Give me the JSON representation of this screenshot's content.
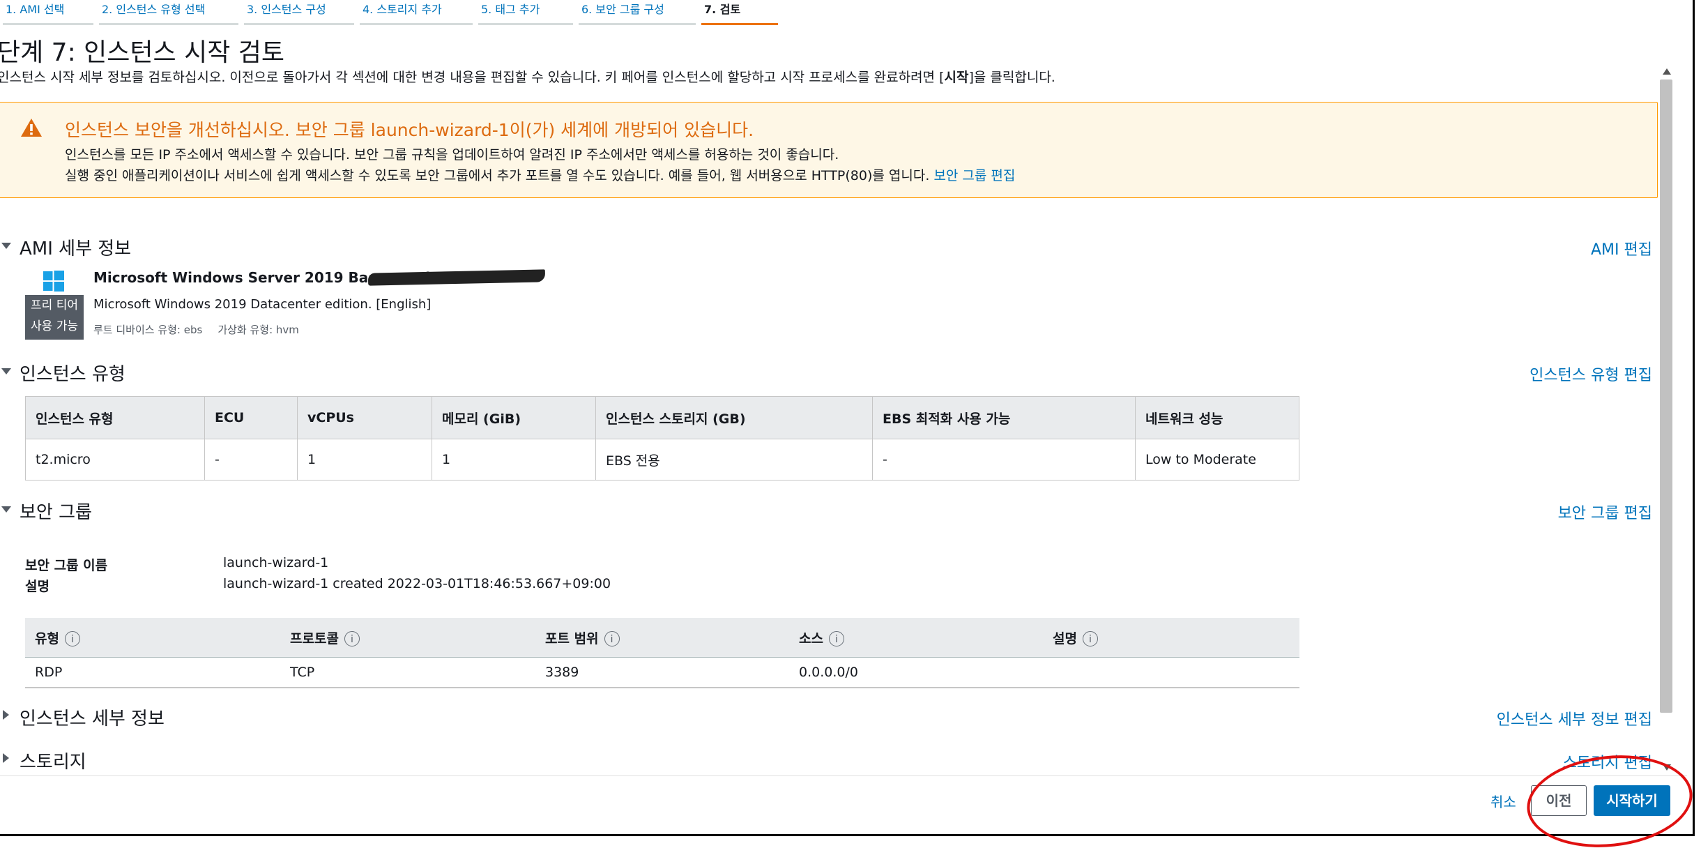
{
  "steps": [
    {
      "label": "1. AMI 선택"
    },
    {
      "label": "2. 인스턴스 유형 선택"
    },
    {
      "label": "3. 인스턴스 구성"
    },
    {
      "label": "4. 스토리지 추가"
    },
    {
      "label": "5. 태그 추가"
    },
    {
      "label": "6. 보안 그룹 구성"
    },
    {
      "label": "7. 검토"
    }
  ],
  "page": {
    "title": "단계 7: 인스턴스 시작 검토",
    "description_prefix": "인스턴스 시작 세부 정보를 검토하십시오. 이전으로 돌아가서 각 섹션에 대한 변경 내용을 편집할 수 있습니다. 키 페어를 인스턴스에 할당하고 시작 프로세스를 완료하려면 [",
    "description_bold": "시작",
    "description_suffix": "]을 클릭합니다."
  },
  "warning": {
    "title": "인스턴스 보안을 개선하십시오. 보안 그룹 launch-wizard-1이(가) 세계에 개방되어 있습니다.",
    "line1": "인스턴스를 모든 IP 주소에서 액세스할 수 있습니다. 보안 그룹 규칙을 업데이트하여 알려진 IP 주소에서만 액세스를 허용하는 것이 좋습니다.",
    "line2": "실행 중인 애플리케이션이나 서비스에 쉽게 액세스할 수 있도록 보안 그룹에서 추가 포트를 열 수도 있습니다. 예를 들어, 웹 서버용으로 HTTP(80)를 엽니다.",
    "link": "보안 그룹 편집",
    "color": "#ff9900"
  },
  "ami": {
    "section_title": "AMI 세부 정보",
    "edit": "AMI 편집",
    "name": "Microsoft Windows Server 2019 Base - ami-0",
    "description": "Microsoft Windows 2019 Datacenter edition. [English]",
    "root_device": "루트 디바이스 유형: ebs",
    "virtualization": "가상화 유형: hvm",
    "tier_line1": "프리 티어",
    "tier_line2": "사용 가능",
    "icon": "windows-logo-icon"
  },
  "instance_type": {
    "section_title": "인스턴스 유형",
    "edit": "인스턴스 유형 편집",
    "headers": [
      "인스턴스 유형",
      "ECU",
      "vCPUs",
      "메모리 (GiB)",
      "인스턴스 스토리지 (GB)",
      "EBS 최적화 사용 가능",
      "네트워크 성능"
    ],
    "row": [
      "t2.micro",
      "-",
      "1",
      "1",
      "EBS 전용",
      "-",
      "Low to Moderate"
    ]
  },
  "security": {
    "section_title": "보안 그룹",
    "edit": "보안 그룹 편집",
    "name_label": "보안 그룹 이름",
    "name_value": "launch-wizard-1",
    "desc_label": "설명",
    "desc_value": "launch-wizard-1 created 2022-03-01T18:46:53.667+09:00",
    "headers": [
      "유형",
      "프로토콜",
      "포트 범위",
      "소스",
      "설명"
    ],
    "row": [
      "RDP",
      "TCP",
      "3389",
      "0.0.0.0/0",
      ""
    ]
  },
  "instance_details": {
    "section_title": "인스턴스 세부 정보",
    "edit": "인스턴스 세부 정보 편집"
  },
  "storage": {
    "section_title": "스토리지",
    "edit": "스토리지 편집"
  },
  "footer": {
    "cancel": "취소",
    "previous": "이전",
    "launch": "시작하기",
    "primary_color": "#0073bb"
  },
  "info_icon": "i"
}
